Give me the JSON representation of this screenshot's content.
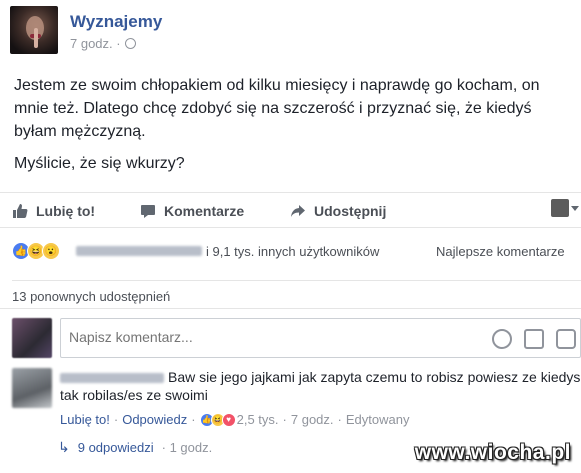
{
  "post": {
    "page_name": "Wyznajemy",
    "time": "7 godz. ·",
    "paragraphs": [
      "Jestem ze swoim chłopakiem od kilku miesięcy i naprawdę go kocham, on mnie też. Dlatego chcę zdobyć się na szczerość i przyznać się, że kiedyś byłam mężczyzną.",
      "Myślicie, że się wkurzy?"
    ]
  },
  "actions": {
    "like_label": "Lubię to!",
    "comment_label": "Komentarze",
    "share_label": "Udostępnij"
  },
  "reactions": {
    "count_text": "i 9,1 tys. innych użytkowników",
    "top_comments_label": "Najlepsze komentarze"
  },
  "shares": {
    "text": "13 ponownych udostępnień"
  },
  "composer": {
    "placeholder": "Napisz komentarz..."
  },
  "comment": {
    "text": "Baw sie jego jajkami jak zapyta czemu to robisz powiesz ze kiedys tak robilas/es ze swoimi",
    "like_link": "Lubię to!",
    "separator": "·",
    "reply_link": "Odpowiedz",
    "reaction_count": "2,5 tys.",
    "time": "7 godz.",
    "edited": "Edytowany"
  },
  "replies": {
    "label": "9 odpowiedzi",
    "time": "· 1 godz."
  },
  "watermark": "www.wiocha.pl",
  "colors": {
    "link": "#365899",
    "secondary_text": "#90949c",
    "like_blue": "#4a7cf0"
  }
}
